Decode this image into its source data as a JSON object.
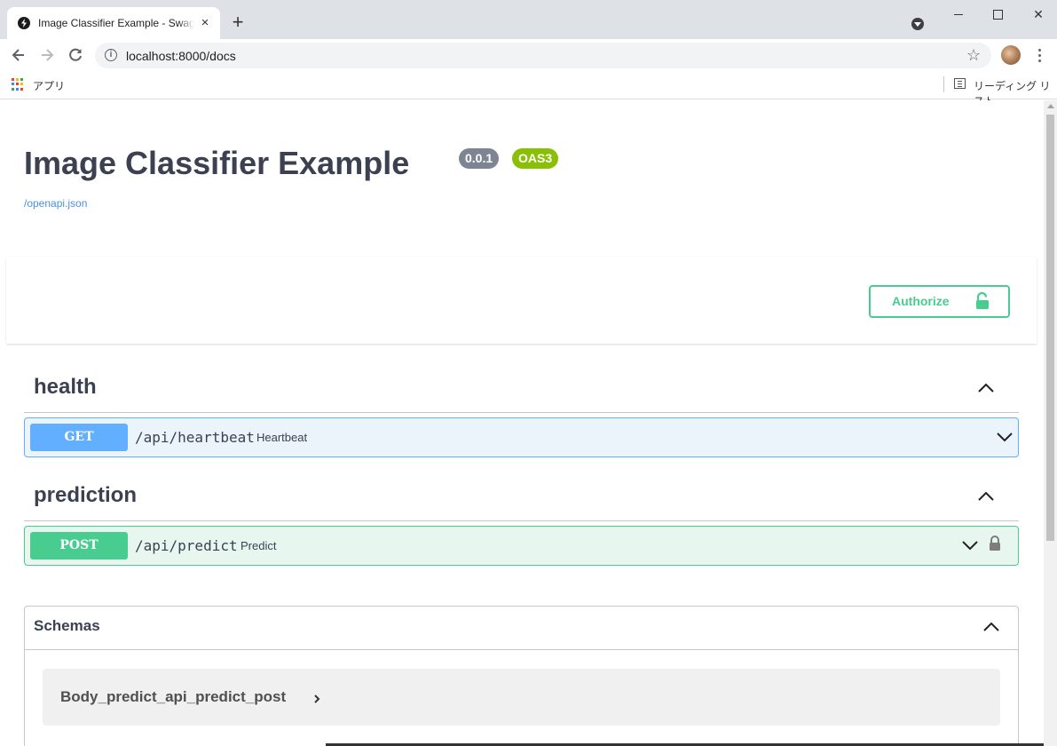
{
  "browser": {
    "tab_title": "Image Classifier Example - Swagger UI",
    "tab_close": "×",
    "new_tab": "+",
    "url": "localhost:8000/docs",
    "info_glyph": "i",
    "star_glyph": "☆",
    "bookmarks": {
      "apps_label": "アプリ",
      "reading_list_label": "リーディング リスト"
    }
  },
  "page": {
    "title": "Image Classifier Example",
    "version": "0.0.1",
    "oas_badge": "OAS3",
    "openapi_link": "/openapi.json",
    "authorize_label": "Authorize",
    "tags": [
      {
        "name": "health",
        "operations": [
          {
            "method": "GET",
            "path": "/api/heartbeat",
            "summary": "Heartbeat",
            "locked": false
          }
        ]
      },
      {
        "name": "prediction",
        "operations": [
          {
            "method": "POST",
            "path": "/api/predict",
            "summary": "Predict",
            "locked": true
          }
        ]
      }
    ],
    "schemas": {
      "title": "Schemas",
      "models": [
        "Body_predict_api_predict_post"
      ]
    }
  },
  "colors": {
    "get": "#61affe",
    "post": "#49cc90",
    "title_text": "#3b4151",
    "version_badge": "#7d8492",
    "oas_badge": "#89bf04",
    "link": "#4990e2"
  }
}
